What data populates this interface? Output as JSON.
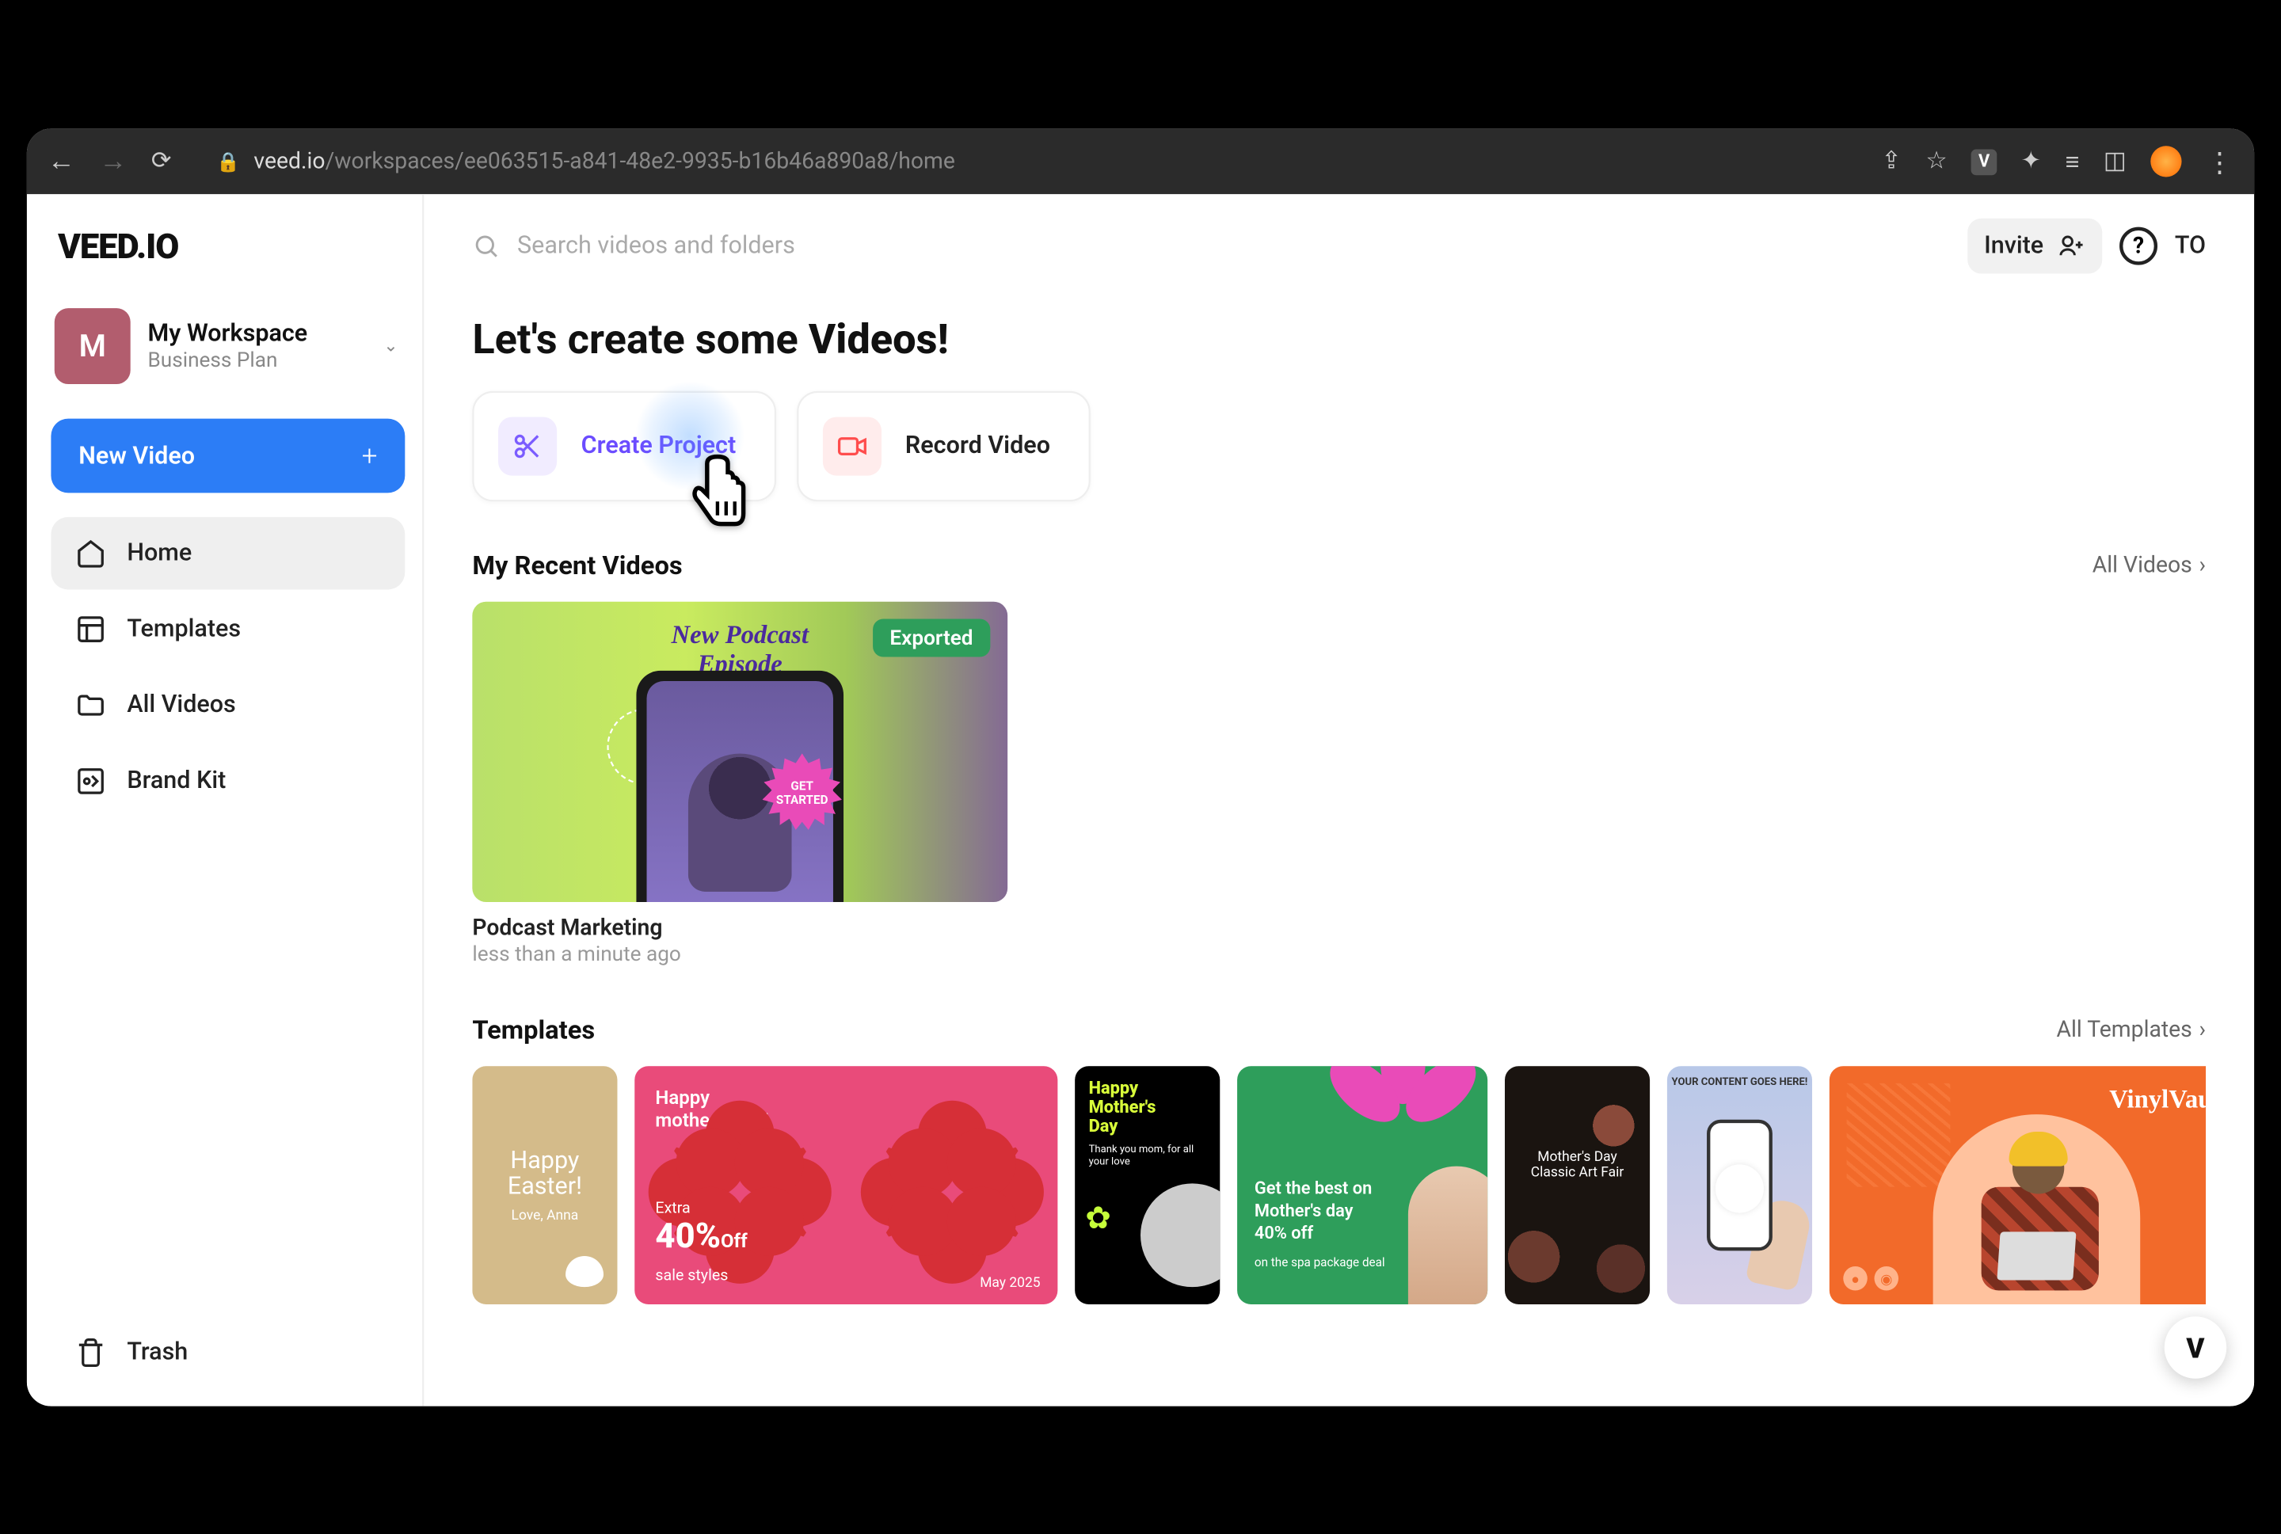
{
  "browser": {
    "url_host": "veed.io",
    "url_path": "/workspaces/ee063515-a841-48e2-9935-b16b46a890a8/home",
    "extension_badge": "V"
  },
  "logo": "VEED.IO",
  "workspace": {
    "initial": "M",
    "name": "My Workspace",
    "plan": "Business Plan"
  },
  "sidebar": {
    "new_video": "New Video",
    "items": [
      {
        "label": "Home"
      },
      {
        "label": "Templates"
      },
      {
        "label": "All Videos"
      },
      {
        "label": "Brand Kit"
      }
    ],
    "trash": "Trash"
  },
  "topbar": {
    "search_placeholder": "Search videos and folders",
    "invite": "Invite",
    "help": "?",
    "user_initials": "TO"
  },
  "headline": {
    "prefix": "Let's create some ",
    "bold": "Videos!"
  },
  "actions": {
    "create": "Create Project",
    "record": "Record Video"
  },
  "recent": {
    "title": "My Recent Videos",
    "all_link": "All Videos",
    "videos": [
      {
        "title": "Podcast Marketing",
        "meta": "less than a minute ago",
        "badge": "Exported",
        "thumb_line1": "New Podcast",
        "thumb_line2": "Episode",
        "burst_line1": "GET",
        "burst_line2": "STARTED"
      }
    ]
  },
  "templates": {
    "title": "Templates",
    "all_link": "All Templates",
    "items": [
      {
        "id": "easter",
        "line1": "Happy",
        "line2": "Easter!",
        "sub": "Love,\nAnna"
      },
      {
        "id": "mothers-pink",
        "hdr1": "Happy",
        "hdr2": "mother's day!",
        "promo_prefix": "Extra",
        "promo_big": "40%",
        "promo_off": "Off",
        "promo_small": "sale styles",
        "date": "May 2025"
      },
      {
        "id": "mothers-black",
        "line1": "Happy",
        "line2": "Mother's",
        "line3": "Day",
        "sub": "Thank you mom, for all your love"
      },
      {
        "id": "spa-green",
        "line1": "Get the best on",
        "line2": "Mother's day",
        "line3": "40% off",
        "sub": "on the spa package deal"
      },
      {
        "id": "art-fair",
        "line1": "Mother's Day",
        "line2": "Classic Art Fair"
      },
      {
        "id": "phone-content",
        "txt": "YOUR CONTENT GOES HERE!"
      },
      {
        "id": "vinyl",
        "logo": "VinylVault"
      }
    ]
  },
  "fab": "V"
}
